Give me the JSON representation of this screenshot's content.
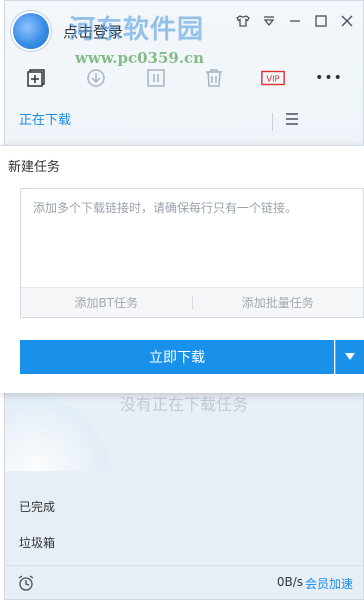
{
  "header": {
    "login_label": "点击登录",
    "watermark_cn": "河东软件园",
    "watermark_url": "www.pc0359.cn"
  },
  "window_controls": {
    "skin_icon": "shirt-icon",
    "menu_icon": "chevron-down-outline-icon",
    "minimize_icon": "minimize-icon",
    "maximize_icon": "maximize-icon",
    "close_icon": "close-icon"
  },
  "toolbar": {
    "new_icon": "new-task-icon",
    "start_icon": "download-start-icon",
    "pause_icon": "pause-icon",
    "delete_icon": "trash-icon",
    "vip_icon": "vip-icon",
    "more_icon": "more-icon",
    "vip_text": "VIP",
    "more_text": "•••"
  },
  "tabs": {
    "downloading": "正在下载"
  },
  "main": {
    "empty_text": "没有正在下载任务"
  },
  "sidebar": {
    "completed": "已完成",
    "trash": "垃圾箱"
  },
  "footer": {
    "speed": "0B/s",
    "vip_speed": "会员加速"
  },
  "dialog": {
    "title": "新建任务",
    "placeholder": "添加多个下载链接时，请确保每行只有一个链接。",
    "add_bt": "添加BT任务",
    "add_batch": "添加批量任务",
    "download_now": "立即下载"
  },
  "colors": {
    "accent": "#1991ea",
    "link": "#1a8ce8",
    "vip": "#e0312f"
  }
}
